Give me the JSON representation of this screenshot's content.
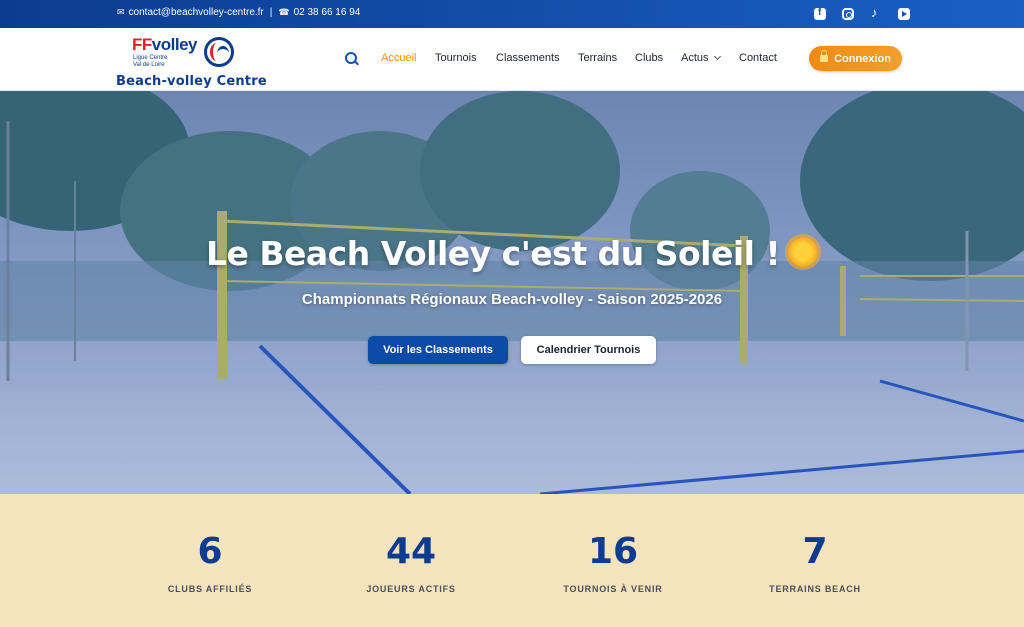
{
  "topbar": {
    "email": "contact@beachvolley-centre.fr",
    "separator": "|",
    "phone": "02 38 66 16 94",
    "socials": [
      "facebook-icon",
      "instagram-icon",
      "tiktok-icon",
      "youtube-icon"
    ]
  },
  "logo": {
    "brand_ff": "FF",
    "brand_volley": "volley",
    "ligue_line1": "Ligue Centre",
    "ligue_line2": "Val de Loire",
    "subtitle": "Beach-volley Centre"
  },
  "nav": {
    "items": [
      {
        "label": "Accueil",
        "active": true
      },
      {
        "label": "Tournois"
      },
      {
        "label": "Classements"
      },
      {
        "label": "Terrains"
      },
      {
        "label": "Clubs"
      },
      {
        "label": "Actus"
      },
      {
        "label": "Contact"
      }
    ],
    "login_label": "Connexion"
  },
  "hero": {
    "title": "Le Beach Volley c'est du Soleil !",
    "subtitle": "Championnats Régionaux Beach-volley - Saison 2025-2026",
    "primary_button": "Voir les Classements",
    "secondary_button": "Calendrier Tournois"
  },
  "stats": [
    {
      "value": "6",
      "label": "CLUBS AFFILIÉS"
    },
    {
      "value": "44",
      "label": "JOUEURS ACTIFS"
    },
    {
      "value": "16",
      "label": "TOURNOIS À VENIR"
    },
    {
      "value": "7",
      "label": "TERRAINS BEACH"
    }
  ],
  "colors": {
    "primary_blue": "#0b3c8f",
    "accent_orange": "#f08a14",
    "stats_bg": "#f5e3bd"
  }
}
